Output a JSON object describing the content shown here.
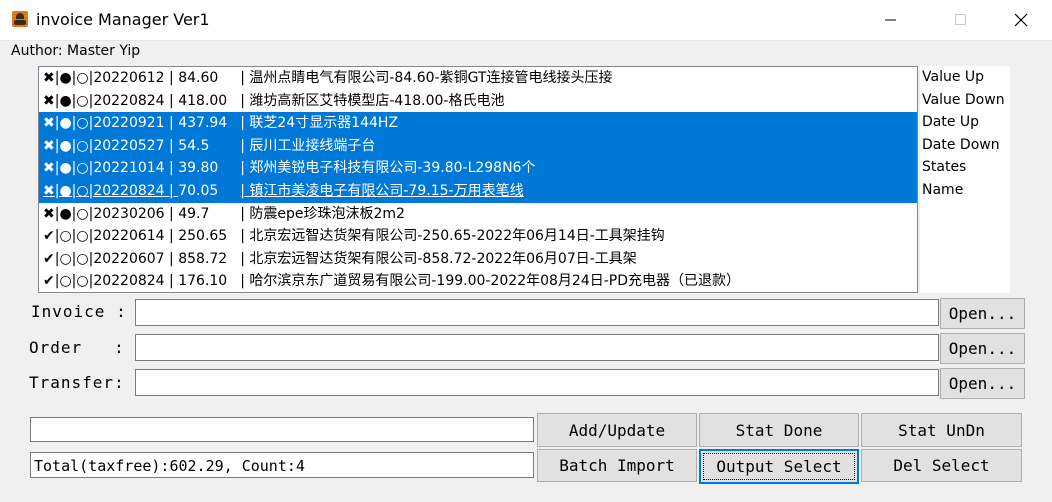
{
  "window": {
    "title": "invoice Manager Ver1",
    "minimize_icon": "minimize-icon",
    "maximize_icon": "maximize-icon",
    "close_icon": "close-icon"
  },
  "menu": {
    "author": "Author: Master Yip"
  },
  "records": [
    {
      "mark": "✖",
      "flags": "|●|○|",
      "date": "20220612",
      "amount": "84.60",
      "desc": "| 温州点睛电气有限公司-84.60-紫铜GT连接管电线接头压接",
      "selected": false
    },
    {
      "mark": "✖",
      "flags": "|●|○|",
      "date": "20220824",
      "amount": "418.00",
      "desc": "| 潍坊高新区艾特模型店-418.00-格氏电池",
      "selected": false
    },
    {
      "mark": "✖",
      "flags": "|●|○|",
      "date": "20220921",
      "amount": "437.94",
      "desc": "| 联芝24寸显示器144HZ",
      "selected": true
    },
    {
      "mark": "✖",
      "flags": "|●|○|",
      "date": "20220527",
      "amount": "54.5",
      "desc": "| 辰川工业接线端子台",
      "selected": true
    },
    {
      "mark": "✖",
      "flags": "|●|○|",
      "date": "20221014",
      "amount": "39.80",
      "desc": "| 郑州美锐电子科技有限公司-39.80-L298N6个",
      "selected": true
    },
    {
      "mark": "✖",
      "flags": "|●|○|",
      "date": "20220824",
      "amount": "70.05",
      "desc": "| 镇江市美凌电子有限公司-79.15-万用表笔线",
      "selected": true
    },
    {
      "mark": "✖",
      "flags": "|●|○|",
      "date": "20230206",
      "amount": "49.7",
      "desc": "| 防震epe珍珠泡沫板2m2",
      "selected": false
    },
    {
      "mark": "✔",
      "flags": "|○|○|",
      "date": "20220614",
      "amount": "250.65",
      "desc": "| 北京宏远智达货架有限公司-250.65-2022年06月14日-工具架挂钩",
      "selected": false
    },
    {
      "mark": "✔",
      "flags": "|○|○|",
      "date": "20220607",
      "amount": "858.72",
      "desc": "| 北京宏远智达货架有限公司-858.72-2022年06月07日-工具架",
      "selected": false
    },
    {
      "mark": "✔",
      "flags": "|○|○|",
      "date": "20220824",
      "amount": "176.10",
      "desc": "| 哈尔滨京东广道贸易有限公司-199.00-2022年08月24日-PD充电器（已退款）",
      "selected": false
    }
  ],
  "sort_options": [
    "Value Up",
    "Value Down",
    "Date Up",
    "Date Down",
    "States",
    "Name"
  ],
  "fields": {
    "invoice_label": "Invoice :",
    "order_label": "Order   :",
    "transfer_label": "Transfer:",
    "invoice_value": "",
    "order_value": "",
    "transfer_value": "",
    "open_label": "Open..."
  },
  "buttons": {
    "add_update": "Add/Update",
    "stat_done": "Stat Done",
    "stat_undn": "Stat UnDn",
    "batch_import": "Batch Import",
    "output_select": "Output Select",
    "del_select": "Del Select"
  },
  "status": {
    "input_value": "",
    "total": "Total(taxfree):602.29, Count:4"
  }
}
